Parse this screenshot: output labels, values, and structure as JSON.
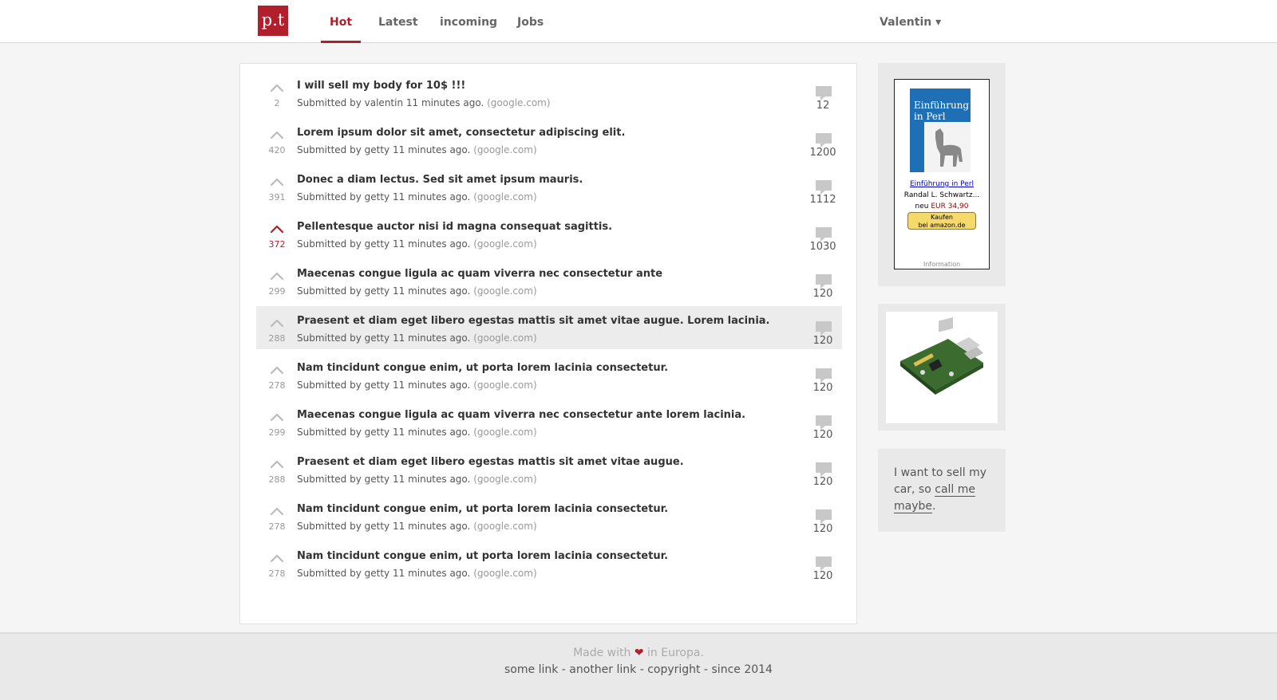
{
  "header": {
    "logo_text": "p.t",
    "nav": [
      "Hot",
      "Latest",
      "incoming",
      "Jobs"
    ],
    "active_nav": "Hot",
    "user": "Valentin ▾"
  },
  "colors": {
    "accent": "#b11f2d",
    "upvote_inactive": "#bbbbbb",
    "comment_icon": "#c8c8c8"
  },
  "posts": [
    {
      "title": "I will sell my body for 10$ !!!",
      "votes": "2",
      "user": "valentin",
      "comments": "12",
      "domain": "(google.com)",
      "voted": false,
      "highlight": false
    },
    {
      "title": "Lorem ipsum dolor sit amet, consectetur adipiscing elit.",
      "votes": "420",
      "user": "getty",
      "comments": "1200",
      "domain": "(google.com)",
      "voted": false,
      "highlight": false
    },
    {
      "title": "Donec a diam lectus. Sed sit amet ipsum mauris.",
      "votes": "391",
      "user": "getty",
      "comments": "1112",
      "domain": "(google.com)",
      "voted": false,
      "highlight": false
    },
    {
      "title": "Pellentesque auctor nisi id magna consequat sagittis.",
      "votes": "372",
      "user": "getty",
      "comments": "1030",
      "domain": "(google.com)",
      "voted": true,
      "highlight": false
    },
    {
      "title": "Maecenas congue ligula ac quam viverra nec consectetur ante",
      "votes": "299",
      "user": "getty",
      "comments": "120",
      "domain": "(google.com)",
      "voted": false,
      "highlight": false
    },
    {
      "title": "Praesent et diam eget libero egestas mattis sit amet vitae augue. Lorem lacinia.",
      "votes": "288",
      "user": "getty",
      "comments": "120",
      "domain": "(google.com)",
      "voted": false,
      "highlight": true
    },
    {
      "title": "Nam tincidunt congue enim, ut porta lorem lacinia consectetur.",
      "votes": "278",
      "user": "getty",
      "comments": "120",
      "domain": "(google.com)",
      "voted": false,
      "highlight": false
    },
    {
      "title": "Maecenas congue ligula ac quam viverra nec consectetur ante lorem lacinia.",
      "votes": "299",
      "user": "getty",
      "comments": "120",
      "domain": "(google.com)",
      "voted": false,
      "highlight": false
    },
    {
      "title": "Praesent et diam eget libero egestas mattis sit amet vitae augue.",
      "votes": "288",
      "user": "getty",
      "comments": "120",
      "domain": "(google.com)",
      "voted": false,
      "highlight": false
    },
    {
      "title": "Nam tincidunt congue enim, ut porta lorem lacinia consectetur.",
      "votes": "278",
      "user": "getty",
      "comments": "120",
      "domain": "(google.com)",
      "voted": false,
      "highlight": false
    },
    {
      "title": "Nam tincidunt congue enim, ut porta lorem lacinia consectetur.",
      "votes": "278",
      "user": "getty",
      "comments": "120",
      "domain": "(google.com)",
      "voted": false,
      "highlight": false
    }
  ],
  "post_meta": {
    "prefix": "Submitted by",
    "time": "11 minutes ago."
  },
  "sidebar": {
    "ad": {
      "book_title": "Einführung in Perl",
      "title": "Einführung in Perl",
      "author": "Randal L. Schwartz...",
      "price_label": "neu",
      "price": "EUR 34,90",
      "buy_line1": "Kaufen",
      "buy_line2": "bei amazon.de",
      "info": "Information"
    },
    "promo": {
      "text": "I want to sell my car, so",
      "link": "call me maybe",
      "suffix": "."
    }
  },
  "footer": {
    "made_prefix": "Made with",
    "heart": "❤",
    "made_suffix": "in Europa.",
    "links": [
      "some link",
      "another link",
      "copyright",
      "since 2014"
    ],
    "separator": " - "
  }
}
